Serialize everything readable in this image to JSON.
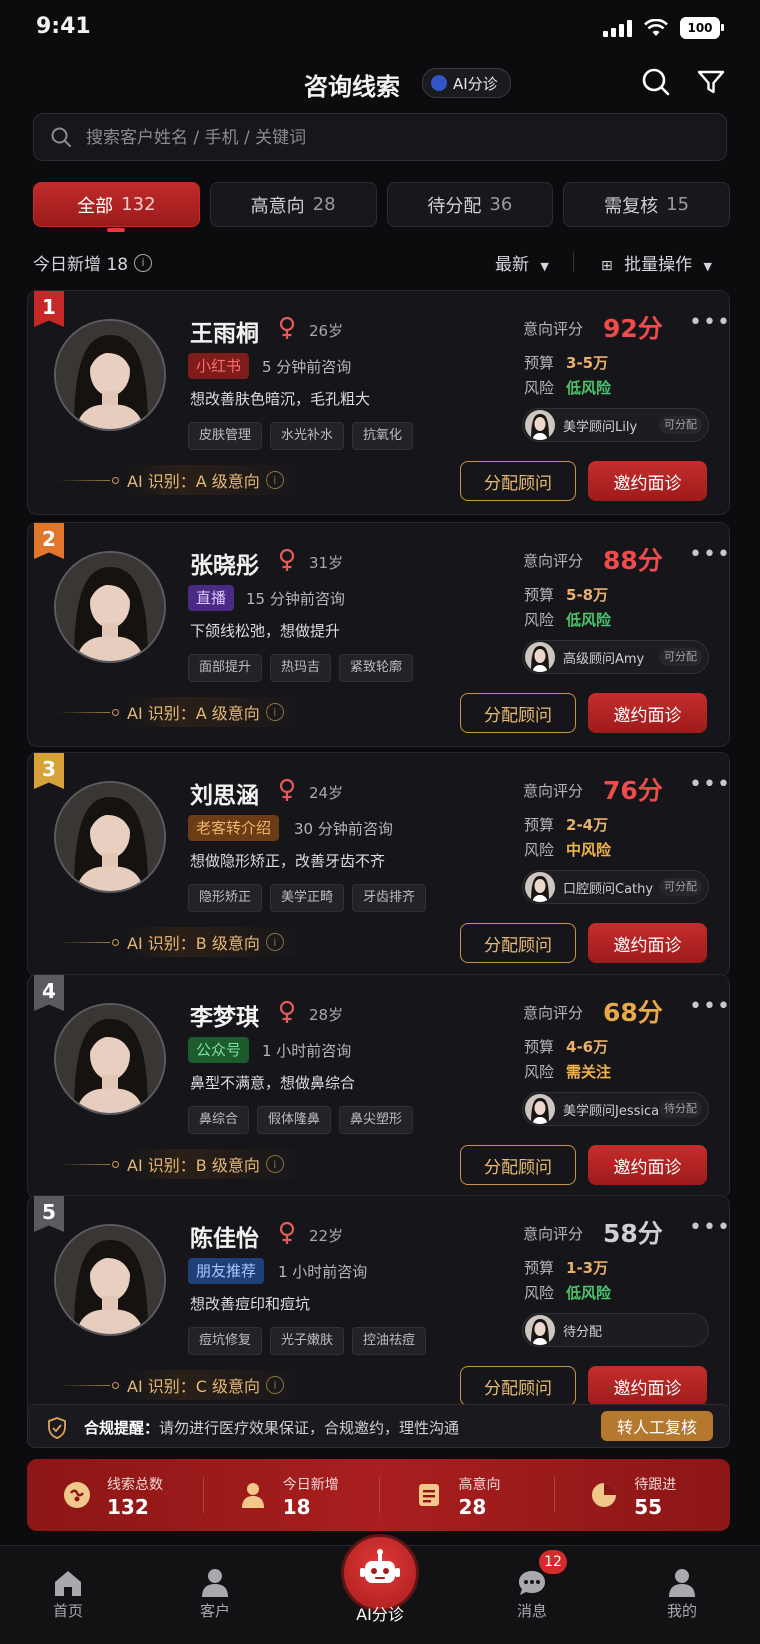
{
  "status": {
    "time": "9:41",
    "battery": "100"
  },
  "header": {
    "title": "咨询线索",
    "ai_chip": "AI分诊"
  },
  "search": {
    "placeholder": "搜索客户姓名 / 手机 / 关键词"
  },
  "tabs": [
    {
      "label": "全部",
      "count": "132"
    },
    {
      "label": "高意向",
      "count": "28"
    },
    {
      "label": "待分配",
      "count": "36"
    },
    {
      "label": "需复核",
      "count": "15"
    }
  ],
  "subbar": {
    "today_new": "今日新增 18",
    "sort": "最新",
    "batch": "批量操作"
  },
  "labels": {
    "score": "意向评分",
    "budget": "预算",
    "risk": "风险",
    "assign": "分配顾问",
    "invite": "邀约面诊"
  },
  "leads": [
    {
      "rank": "1",
      "rank_color": "#c62828",
      "name": "王雨桐",
      "age": "26岁",
      "source": "小红书",
      "source_bg": "#7e1c1c",
      "source_fg": "#ff6b6b",
      "ago": "5 分钟前咨询",
      "concern": "想改善肤色暗沉，毛孔粗大",
      "tags": [
        "皮肤管理",
        "水光补水",
        "抗氧化"
      ],
      "ai": "AI 识别：A 级意向",
      "score": "92分",
      "score_color": "#ef4b4b",
      "budget": "3-5万",
      "risk": "低风险",
      "risk_color": "#49c46b",
      "consultant": "美学顾问Lily",
      "consultant_status": "可分配",
      "has_consultant_avatar": true
    },
    {
      "rank": "2",
      "rank_color": "#e0772c",
      "name": "张晓彤",
      "age": "31岁",
      "source": "直播",
      "source_bg": "#4b2a86",
      "source_fg": "#d9c7ff",
      "ago": "15 分钟前咨询",
      "concern": "下颌线松弛，想做提升",
      "tags": [
        "面部提升",
        "热玛吉",
        "紧致轮廓"
      ],
      "ai": "AI 识别：A 级意向",
      "score": "88分",
      "score_color": "#ef4b4b",
      "budget": "5-8万",
      "risk": "低风险",
      "risk_color": "#49c46b",
      "consultant": "高级顾问Amy",
      "consultant_status": "可分配",
      "has_consultant_avatar": true
    },
    {
      "rank": "3",
      "rank_color": "#d8a23a",
      "name": "刘思涵",
      "age": "24岁",
      "source": "老客转介绍",
      "source_bg": "#6b3c15",
      "source_fg": "#f0b56b",
      "ago": "30 分钟前咨询",
      "concern": "想做隐形矫正，改善牙齿不齐",
      "tags": [
        "隐形矫正",
        "美学正畸",
        "牙齿排齐"
      ],
      "ai": "AI 识别：B 级意向",
      "score": "76分",
      "score_color": "#ef4b4b",
      "budget": "2-4万",
      "risk": "中风险",
      "risk_color": "#f0b24a",
      "consultant": "口腔顾问Cathy",
      "consultant_status": "可分配",
      "has_consultant_avatar": true
    },
    {
      "rank": "4",
      "rank_color": "#5a5a60",
      "name": "李梦琪",
      "age": "28岁",
      "source": "公众号",
      "source_bg": "#1d5a2e",
      "source_fg": "#7be39a",
      "ago": "1 小时前咨询",
      "concern": "鼻型不满意，想做鼻综合",
      "tags": [
        "鼻综合",
        "假体隆鼻",
        "鼻尖塑形"
      ],
      "ai": "AI 识别：B 级意向",
      "score": "68分",
      "score_color": "#e8a94a",
      "budget": "4-6万",
      "risk": "需关注",
      "risk_color": "#f0b24a",
      "consultant": "美学顾问Jessica",
      "consultant_status": "待分配",
      "has_consultant_avatar": true
    },
    {
      "rank": "5",
      "rank_color": "#5a5a60",
      "name": "陈佳怡",
      "age": "22岁",
      "source": "朋友推荐",
      "source_bg": "#1f3f7a",
      "source_fg": "#a9c6ff",
      "ago": "1 小时前咨询",
      "concern": "想改善痘印和痘坑",
      "tags": [
        "痘坑修复",
        "光子嫩肤",
        "控油祛痘"
      ],
      "ai": "AI 识别：C 级意向",
      "score": "58分",
      "score_color": "#d0d0d4",
      "budget": "1-3万",
      "risk": "低风险",
      "risk_color": "#49c46b",
      "consultant": "待分配",
      "consultant_status": "",
      "has_consultant_avatar": true
    }
  ],
  "compliance": {
    "prefix": "合规提醒：",
    "text": "请勿进行医疗效果保证，合规邀约，理性沟通",
    "button": "转人工复核"
  },
  "stats": [
    {
      "label": "线索总数",
      "value": "132"
    },
    {
      "label": "今日新增",
      "value": "18"
    },
    {
      "label": "高意向",
      "value": "28"
    },
    {
      "label": "待跟进",
      "value": "55"
    }
  ],
  "nav": {
    "home": "首页",
    "customer": "客户",
    "ai": "AI分诊",
    "message": "消息",
    "message_badge": "12",
    "mine": "我的"
  }
}
